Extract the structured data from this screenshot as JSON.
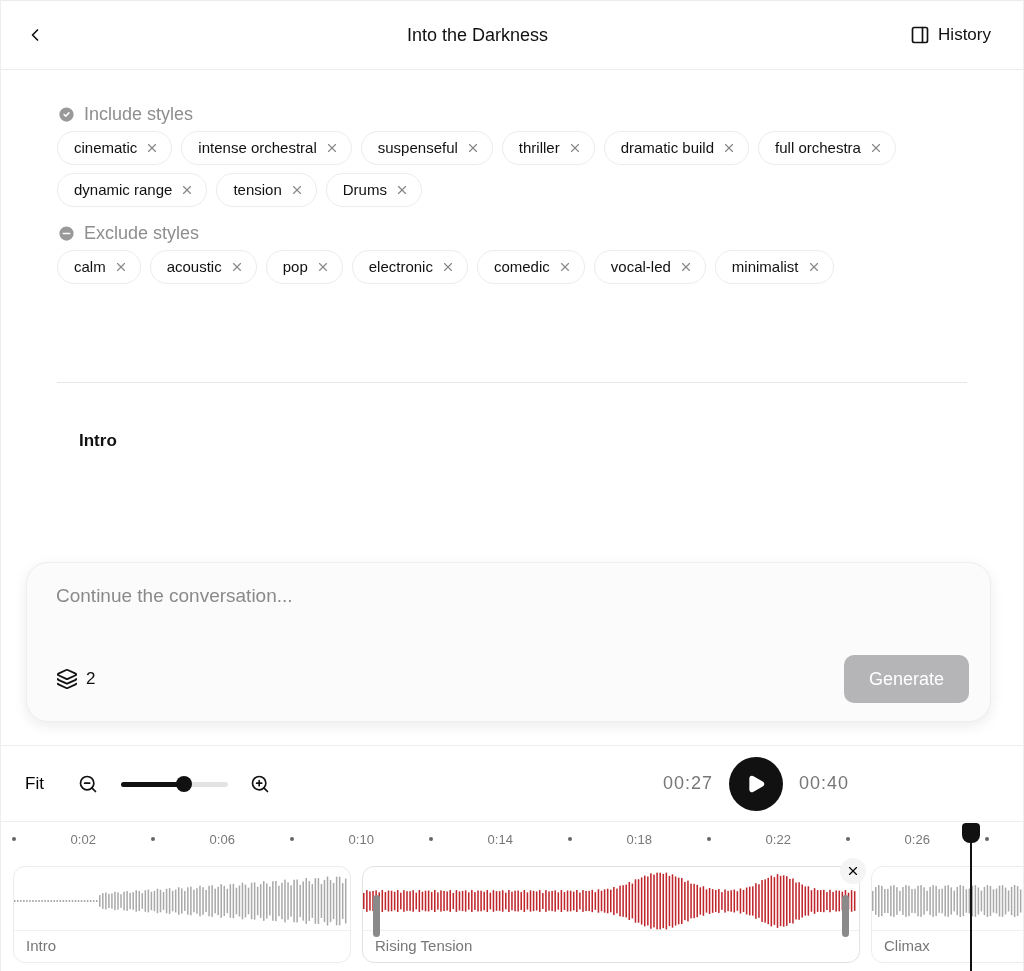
{
  "header": {
    "title": "Into the Darkness",
    "history_label": "History"
  },
  "style_groups": [
    {
      "kind": "include",
      "label": "Include styles",
      "tags": [
        "cinematic",
        "intense orchestral",
        "suspenseful",
        "thriller",
        "dramatic build",
        "full orchestra",
        "dynamic range",
        "tension",
        "Drums"
      ]
    },
    {
      "kind": "exclude",
      "label": "Exclude styles",
      "tags": [
        "calm",
        "acoustic",
        "pop",
        "electronic",
        "comedic",
        "vocal-led",
        "minimalist"
      ]
    }
  ],
  "sections": [
    {
      "title": "Intro"
    }
  ],
  "composer": {
    "placeholder": "Continue the conversation...",
    "layer_count": "2",
    "generate_label": "Generate",
    "generate_disabled": true
  },
  "timeline": {
    "fit_label": "Fit",
    "zoom": {
      "level": 0.59
    },
    "current_time": "00:27",
    "total_time": "00:40",
    "ruler_labels": [
      "0:02",
      "0:06",
      "0:10",
      "0:14",
      "0:18",
      "0:22",
      "0:26"
    ],
    "clips": [
      {
        "label": "Intro",
        "selected": false
      },
      {
        "label": "Rising Tension",
        "selected": true
      },
      {
        "label": "Climax",
        "selected": false
      }
    ]
  }
}
